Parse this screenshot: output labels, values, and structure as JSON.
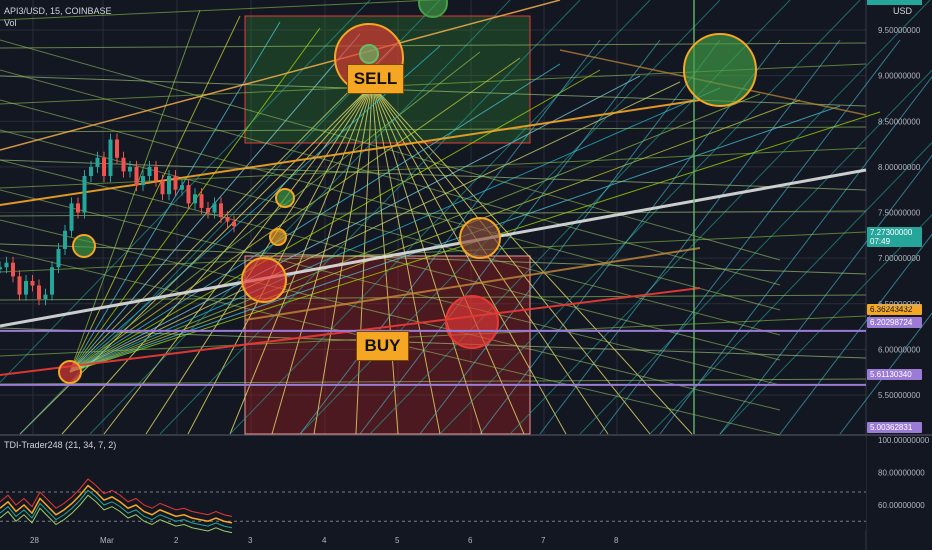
{
  "header": {
    "symbol_line": "API3/USD, 15, COINBASE",
    "volume_label": "Vol",
    "currency": "USD"
  },
  "indicator": {
    "label": "TDI-Trader248 (21, 34, 7, 2)"
  },
  "annotations": {
    "sell": "SELL",
    "buy": "BUY"
  },
  "colors": {
    "background": "#131722",
    "grid": "#2a2e39",
    "sell_zone": "#2e7d32",
    "buy_zone": "#b71c1c",
    "label_orange": "#f5a623",
    "trend_white": "#e0e0e0",
    "trend_red": "#e53935",
    "level_purple": "#9c7bd6",
    "vertical_green": "#66bb6a"
  },
  "chart_data": [
    {
      "type": "line",
      "title": "API3/USD, 15, COINBASE",
      "x_tick_labels": [
        "28",
        "Mar",
        "2",
        "3",
        "4",
        "5",
        "6",
        "7",
        "8"
      ],
      "y_tick_labels": [
        "9.50000000",
        "9.00000000",
        "8.50000000",
        "8.00000000",
        "7.50000000",
        "7.00000000",
        "6.50000000",
        "6.00000000",
        "5.50000000"
      ],
      "ylim": [
        5.0,
        9.9
      ],
      "price_badges": [
        {
          "value": "7.27300000",
          "sub": "07:49",
          "color": "#26a69a"
        },
        {
          "value": "6.36243432",
          "color": "#f5a623"
        },
        {
          "value": "6.20298724",
          "color": "#9c7bd6"
        },
        {
          "value": "5.61130340",
          "color": "#9c7bd6"
        },
        {
          "value": "5.00362831",
          "color": "#9c7bd6"
        }
      ],
      "horizontal_levels": [
        6.20298724,
        5.6113034,
        5.00362831
      ],
      "price_series": {
        "x": [
          0,
          0.5,
          1,
          1.5,
          2,
          2.5,
          3,
          3.5,
          4,
          4.5,
          5,
          5.5,
          6,
          6.5,
          7,
          7.5,
          8,
          8.5,
          9,
          9.5,
          10,
          10.5,
          11,
          11.5,
          12,
          12.5,
          13,
          13.5,
          14,
          14.5,
          15,
          15.5,
          16,
          16.5,
          17,
          17.5,
          18
        ],
        "values": [
          6.9,
          6.95,
          6.8,
          6.6,
          6.75,
          6.7,
          6.55,
          6.6,
          6.9,
          7.1,
          7.3,
          7.6,
          7.5,
          7.9,
          8.0,
          8.1,
          7.9,
          8.3,
          8.1,
          7.95,
          8.0,
          7.8,
          7.9,
          8.0,
          7.85,
          7.7,
          7.9,
          7.75,
          7.8,
          7.6,
          7.7,
          7.55,
          7.5,
          7.6,
          7.45,
          7.4,
          7.35
        ]
      }
    },
    {
      "type": "line",
      "title": "TDI-Trader248 (21, 34, 7, 2)",
      "y_tick_labels": [
        "100.00000000",
        "80.00000000",
        "60.00000000"
      ],
      "ylim": [
        50,
        100
      ]
    }
  ]
}
